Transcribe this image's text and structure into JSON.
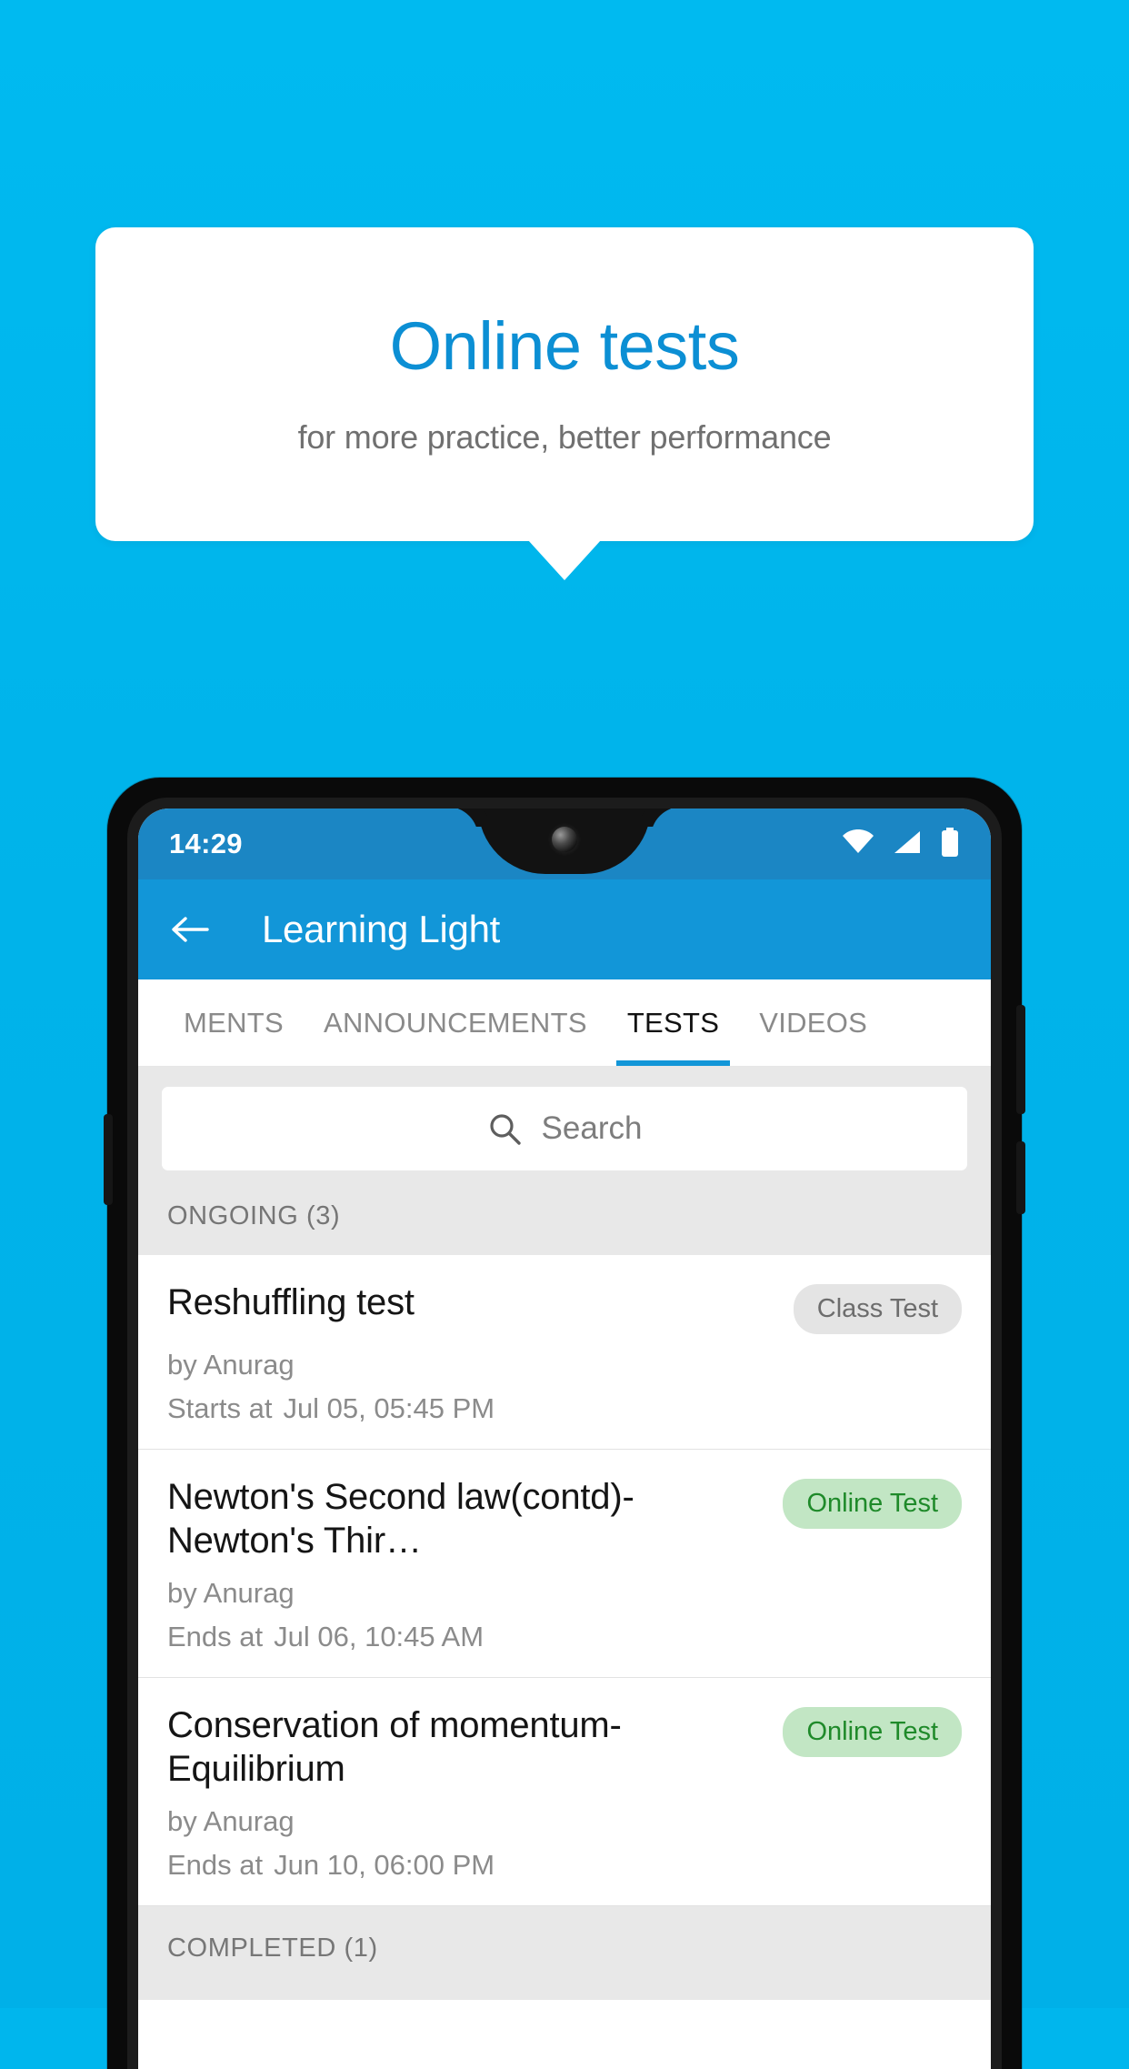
{
  "promo": {
    "title": "Online tests",
    "subtitle": "for more practice, better performance",
    "bg_color": "#00b6ed",
    "title_color": "#0c8fd4"
  },
  "phone": {
    "statusbar": {
      "time": "14:29",
      "icons": [
        "wifi-icon",
        "signal-icon",
        "battery-icon"
      ]
    },
    "appbar": {
      "back_icon": "back-arrow-icon",
      "title": "Learning Light",
      "color": "#1296d8"
    },
    "tabs": [
      {
        "label": "MENTS",
        "active": false
      },
      {
        "label": "ANNOUNCEMENTS",
        "active": false
      },
      {
        "label": "TESTS",
        "active": true
      },
      {
        "label": "VIDEOS",
        "active": false
      }
    ],
    "search": {
      "icon": "search-icon",
      "placeholder": "Search",
      "value": ""
    },
    "sections": [
      {
        "header": "ONGOING (3)",
        "items": [
          {
            "title": "Reshuffling test",
            "badge": "Class Test",
            "badge_type": "class",
            "author": "by Anurag",
            "time_label": "Starts at",
            "time_value": "Jul 05, 05:45 PM"
          },
          {
            "title": "Newton's Second law(contd)-Newton's Thir…",
            "badge": "Online Test",
            "badge_type": "online",
            "author": "by Anurag",
            "time_label": "Ends at",
            "time_value": "Jul 06, 10:45 AM"
          },
          {
            "title": "Conservation of momentum-Equilibrium",
            "badge": "Online Test",
            "badge_type": "online",
            "author": "by Anurag",
            "time_label": "Ends at",
            "time_value": "Jun 10, 06:00 PM"
          }
        ]
      },
      {
        "header": "COMPLETED (1)",
        "items": []
      }
    ],
    "colors": {
      "accent": "#1296d8",
      "badge_online_bg": "#c2e6c4",
      "badge_online_text": "#1f8a2a",
      "badge_class_bg": "#e4e4e4",
      "badge_class_text": "#6d6d6d"
    }
  }
}
